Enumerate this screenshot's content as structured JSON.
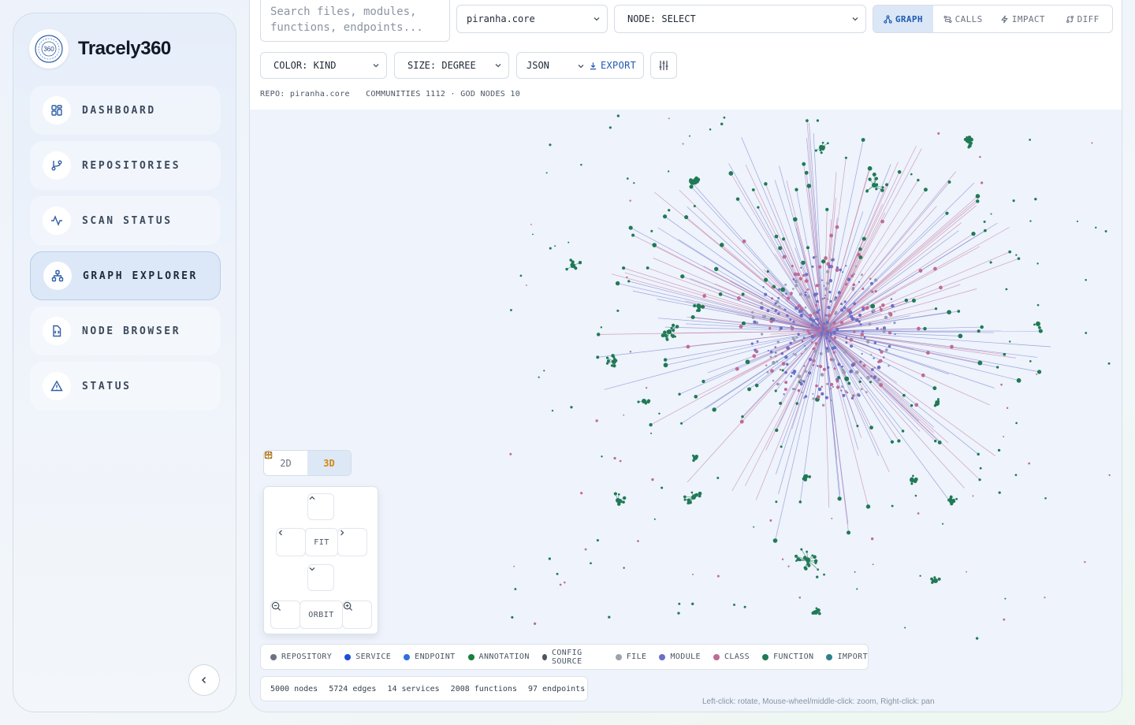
{
  "brand": {
    "name": "Tracely360",
    "logo_text": "360"
  },
  "sidebar": {
    "items": [
      {
        "label": "DASHBOARD",
        "icon": "dashboard-icon",
        "active": false
      },
      {
        "label": "REPOSITORIES",
        "icon": "git-branch-icon",
        "active": false
      },
      {
        "label": "SCAN STATUS",
        "icon": "activity-icon",
        "active": false
      },
      {
        "label": "GRAPH EXPLORER",
        "icon": "network-icon",
        "active": true
      },
      {
        "label": "NODE BROWSER",
        "icon": "file-code-icon",
        "active": false
      },
      {
        "label": "STATUS",
        "icon": "warning-icon",
        "active": false
      }
    ]
  },
  "toolbar": {
    "search_placeholder": "Search files, modules, functions, endpoints...",
    "repo_select": "piranha.core",
    "node_select": "NODE: SELECT",
    "views": [
      "GRAPH",
      "CALLS",
      "IMPACT",
      "DIFF"
    ],
    "active_view": "GRAPH",
    "color_select": "COLOR: KIND",
    "size_select": "SIZE: DEGREE",
    "format_select": "JSON",
    "export_label": "EXPORT"
  },
  "meta": {
    "repo": "REPO: piranha.core",
    "communities": "COMMUNITIES 1112 · GOD NODES 10"
  },
  "view_toggle": {
    "two_d": "2D",
    "three_d": "3D",
    "active": "3D"
  },
  "navpad": {
    "fit": "FIT",
    "orbit": "ORBIT"
  },
  "legend": [
    {
      "label": "REPOSITORY",
      "color": "#6b7280"
    },
    {
      "label": "SERVICE",
      "color": "#1d4ed8"
    },
    {
      "label": "ENDPOINT",
      "color": "#2f6fe0"
    },
    {
      "label": "ANNOTATION",
      "color": "#15803d"
    },
    {
      "label": "CONFIG SOURCE",
      "color": "#4b5563"
    },
    {
      "label": "FILE",
      "color": "#9ca3af"
    },
    {
      "label": "MODULE",
      "color": "#6b6fc8"
    },
    {
      "label": "CLASS",
      "color": "#c06b96"
    },
    {
      "label": "FUNCTION",
      "color": "#1f7a55"
    },
    {
      "label": "IMPORT",
      "color": "#2f7f8f"
    }
  ],
  "stats": {
    "nodes": "5000 nodes",
    "edges": "5724 edges",
    "services": "14 services",
    "functions": "2008 functions",
    "endpoints": "97 endpoints"
  },
  "hint": "Left-click: rotate, Mouse-wheel/middle-click: zoom, Right-click: pan",
  "colors": {
    "accent": "#1e5ab0",
    "active_3d": "#d4880e",
    "edge_module": "#6b6fc8",
    "edge_class": "#c06b96",
    "node_function": "#1f7a55"
  }
}
